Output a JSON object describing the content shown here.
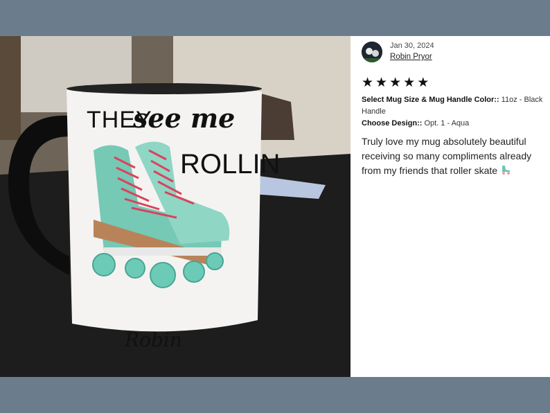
{
  "photo": {
    "mug_text_line1a": "THEY",
    "mug_text_line1b": "see me",
    "mug_text_line2": "ROLLIN",
    "mug_name": "Robin"
  },
  "review": {
    "date": "Jan 30, 2024",
    "author": "Robin Pryor",
    "rating": 5,
    "attr1_label": "Select Mug Size & Mug Handle Color::",
    "attr1_value": " 11oz - Black Handle",
    "attr2_label": "Choose Design::",
    "attr2_value": " Opt. 1 - Aqua",
    "text": "Truly love my mug absolutely beautiful receiving so many compliments already from my friends that roller skate"
  },
  "icons": {
    "avatar": "avatar",
    "star": "star-icon",
    "emoji": "roller-skate-icon"
  },
  "colors": {
    "background": "#6b7d8c",
    "aqua": "#6cc7b2",
    "laces": "#d9435c"
  }
}
